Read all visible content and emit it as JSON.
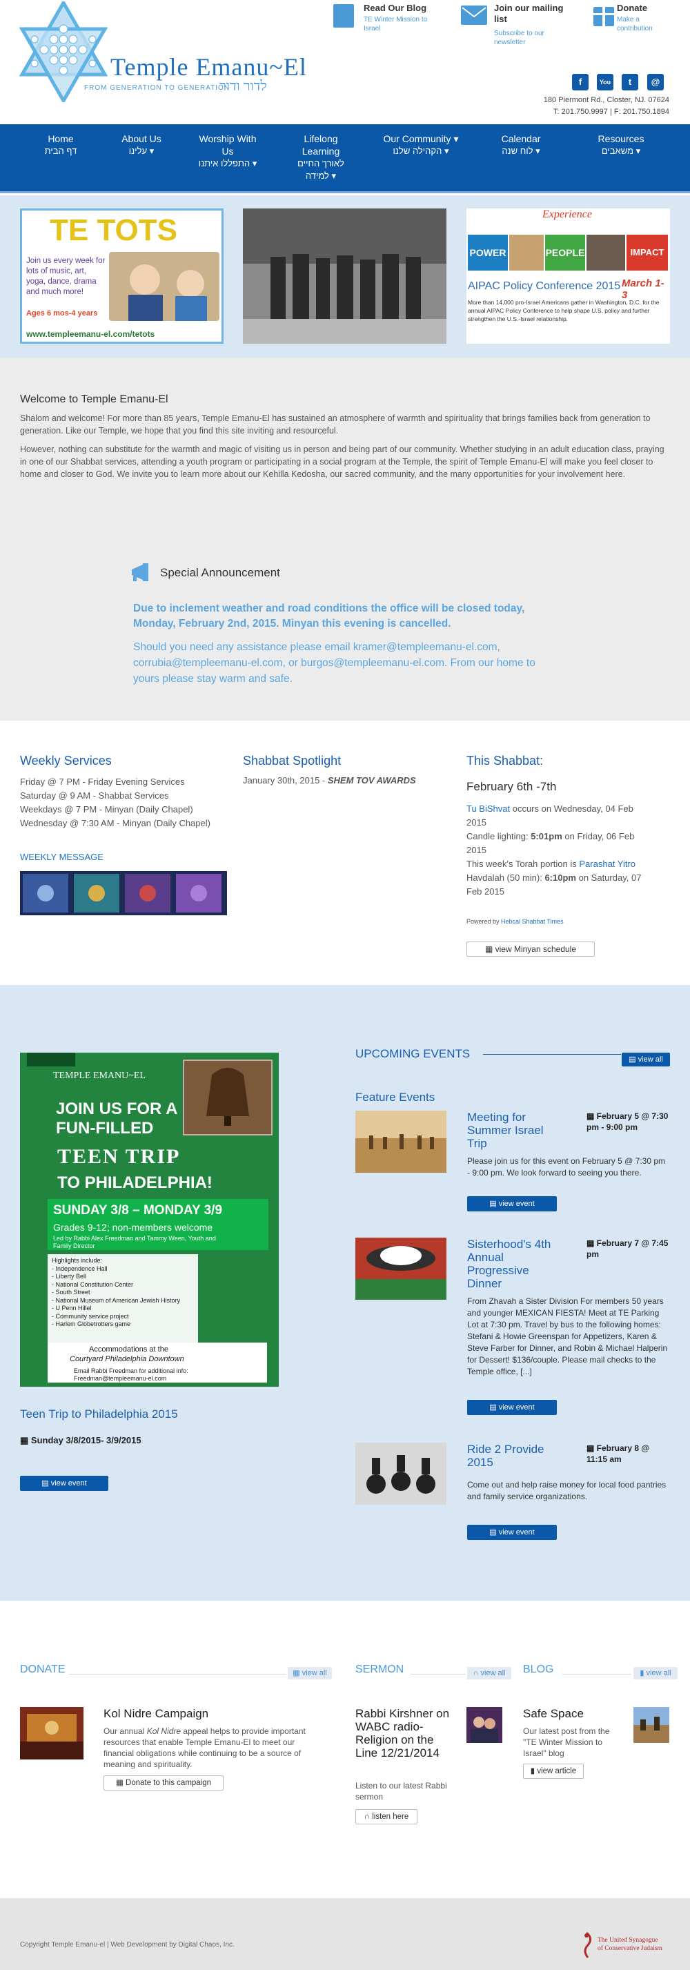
{
  "site": {
    "title": "Temple Emanu~El",
    "tagline": "FROM GENERATION TO GENERATION",
    "hebrew_tagline": "לדור ודור"
  },
  "header_links": [
    {
      "title": "Read Our Blog",
      "sub": "TE Winter Mission to Israel",
      "icon": "book-icon"
    },
    {
      "title": "Join our mailing list",
      "sub": "Subscribe to our newsletter",
      "icon": "envelope-icon"
    },
    {
      "title": "Donate",
      "sub": "Make a contribution",
      "icon": "gift-icon"
    }
  ],
  "social": [
    "f",
    "You",
    "t",
    "@"
  ],
  "address": {
    "line1": "180 Piermont Rd., Closter, NJ. 07624",
    "line2": "T: 201.750.9997 | F: 201.750.1894"
  },
  "nav": [
    {
      "en": "Home",
      "he": "דף הבית"
    },
    {
      "en": "About Us",
      "he": "עלינו ▾"
    },
    {
      "en": "Worship With Us",
      "he": "התפללו איתנו ▾"
    },
    {
      "en": "Lifelong Learning",
      "he": "לאורך החיים למידה ▾"
    },
    {
      "en": "Our Community ▾",
      "he": "הקהילה שלנו ▾"
    },
    {
      "en": "Calendar",
      "he": "לוח שנה ▾"
    },
    {
      "en": "Resources",
      "he": "משאבים ▾"
    }
  ],
  "banners": {
    "tetots": {
      "title": "TE TOTS",
      "text": "Join us every week for lots of music, art, yoga, dance, drama and much more!",
      "ages": "Ages 6 mos-4 years",
      "url": "www.templeemanu-el.com/tetots"
    },
    "aipac": {
      "top": "Experience",
      "words": [
        "POWER",
        "PEOPLE",
        "IMPACT"
      ],
      "title": "AIPAC Policy Conference 2015",
      "dates": "March 1-3",
      "text": "More than 14,000 pro-Israel Americans gather in Washington, D.C. for the annual AIPAC Policy Conference to help shape U.S. policy and further strengthen the U.S.-Israel relationship."
    }
  },
  "welcome": {
    "title": "Welcome to Temple Emanu-El",
    "p1": "Shalom and welcome! For more than 85 years, Temple Emanu-El has sustained an atmosphere of warmth and spirituality that brings families back from generation to generation. Like our Temple, we hope that you find this site inviting and resourceful.",
    "p2": "However, nothing can substitute for the warmth and magic of visiting us in person and being part of our community. Whether studying in an adult education class, praying in one of our Shabbat services, attending a youth program or participating in a social program at the Temple, the spirit of Temple Emanu-El will make you feel closer to home and closer to God. We invite you to learn more about our Kehilla Kedosha, our sacred community, and the many opportunities for your involvement here."
  },
  "announcement": {
    "title": "Special Announcement",
    "bold": "Due to inclement weather and road conditions the office will be closed today, Monday, February 2nd, 2015. Minyan this evening is cancelled.",
    "text": "Should you need any assistance please email kramer@templeemanu-el.com, corrubia@templeemanu-el.com, or burgos@templeemanu-el.com.  From our home to yours please stay warm and safe."
  },
  "weekly": {
    "title": "Weekly Services",
    "lines": [
      "Friday @ 7 PM - Friday Evening Services",
      "Saturday @ 9 AM - Shabbat Services",
      "Weekdays @ 7 PM - Minyan (Daily Chapel)",
      "Wednesday @ 7:30 AM - Minyan (Daily Chapel)"
    ],
    "message_label": "WEEKLY MESSAGE"
  },
  "spotlight": {
    "title": "Shabbat Spotlight",
    "date": "January 30th, 2015 -",
    "tag": "SHEM TOV AWARDS"
  },
  "shabbat": {
    "title": "This Shabbat:",
    "range": "February 6th -7th",
    "tu_link": "Tu BiShvat",
    "tu_text": " occurs on Wednesday, 04 Feb 2015",
    "candle_pre": "Candle lighting: ",
    "candle_time": "5:01pm",
    "candle_post": " on Friday, 06 Feb 2015",
    "torah_pre": "This week's Torah portion is ",
    "torah_link": "Parashat Yitro",
    "havdalah_pre": "Havdalah (50 min): ",
    "havdalah_time": "6:10pm",
    "havdalah_post": " on Saturday, 07 Feb 2015",
    "powered_pre": "Powered by ",
    "powered_link": "Hebcal Shabbat Times",
    "minyan_button": "view Minyan schedule"
  },
  "featured_poster": {
    "brand": "TEMPLE EMANU~EL",
    "l1": "JOIN US FOR A",
    "l2": "FUN-FILLED",
    "l3": "TEEN TRIP",
    "l4": "TO PHILADELPHIA!",
    "dates": "SUNDAY 3/8 – MONDAY 3/9",
    "grades": "Grades 9-12; non-members welcome",
    "led": "Led by Rabbi Alex Freedman and Tammy Ween, Youth and Family Director",
    "highlights_label": "Highlights include:",
    "highlights": [
      "- Independence Hall",
      "- Liberty Bell",
      "- National Constitution Center",
      "- South Street",
      "- National Museum of American Jewish History",
      "- U Penn Hillel",
      "- Community service project",
      "- Harlem Globetrotters game"
    ],
    "accom1": "Accommodations at the",
    "accom2": "Courtyard Philadelphia Downtown",
    "email1": "Email Rabbi Freedman for additional info:",
    "email2": "Freedman@templeemanu-el.com",
    "caption": "Teen Trip to Philadelphia 2015",
    "caption_date": "Sunday 3/8/2015- 3/9/2015",
    "button": "view event"
  },
  "events": {
    "title": "UPCOMING EVENTS",
    "view_all": "view all",
    "feature_label": "Feature Events",
    "items": [
      {
        "title": "Meeting for Summer Israel Trip",
        "date": "February 5 @ 7:30 pm - 9:00 pm",
        "text": "Please join us for this event on February 5 @ 7:30 pm - 9:00 pm. We look forward to seeing you there.",
        "button": "view event"
      },
      {
        "title": "Sisterhood's 4th Annual Progressive Dinner",
        "date": "February 7 @ 7:45 pm",
        "text": "From Zhavah a Sister Division For members 50 years and younger MEXICAN FIESTA! Meet at TE Parking Lot at 7:30 pm.  Travel by bus to the following homes: Stefani & Howie Greenspan for Appetizers, Karen & Steve Farber for Dinner, and Robin & Michael Halperin for Dessert! $136/couple. Please mail checks to the Temple office, [...]",
        "button": "view event"
      },
      {
        "title": "Ride 2 Provide 2015",
        "date": "February 8 @ 11:15 am",
        "text": "Come out and help raise money for local food pantries and family service organizations.",
        "button": "view event"
      }
    ]
  },
  "donate": {
    "heading": "DONATE",
    "view_all": "view all",
    "title": "Kol Nidre Campaign",
    "text_pre": "Our annual ",
    "text_em": "Kol Nidre",
    "text_post": " appeal helps to provide important resources that enable Temple Emanu-El to meet our financial obligations while continuing to be a source of meaning and spirituality.",
    "button": "Donate to this campaign"
  },
  "sermon": {
    "heading": "SERMON",
    "view_all": "view all",
    "title": "Rabbi Kirshner on WABC radio-Religion on the Line 12/21/2014",
    "text": "Listen to our latest Rabbi sermon",
    "button": "listen here"
  },
  "blog": {
    "heading": "BLOG",
    "view_all": "view all",
    "title": "Safe Space",
    "text": "Our latest post from the \"TE Winter Mission to Israel\" blog",
    "button": "view article"
  },
  "footer": {
    "copyright": "Copyright Temple Emanu-el | Web Development by Digital Chaos, Inc.",
    "uscj1": "The United Synagogue",
    "uscj2": "of Conservative Judaism"
  }
}
